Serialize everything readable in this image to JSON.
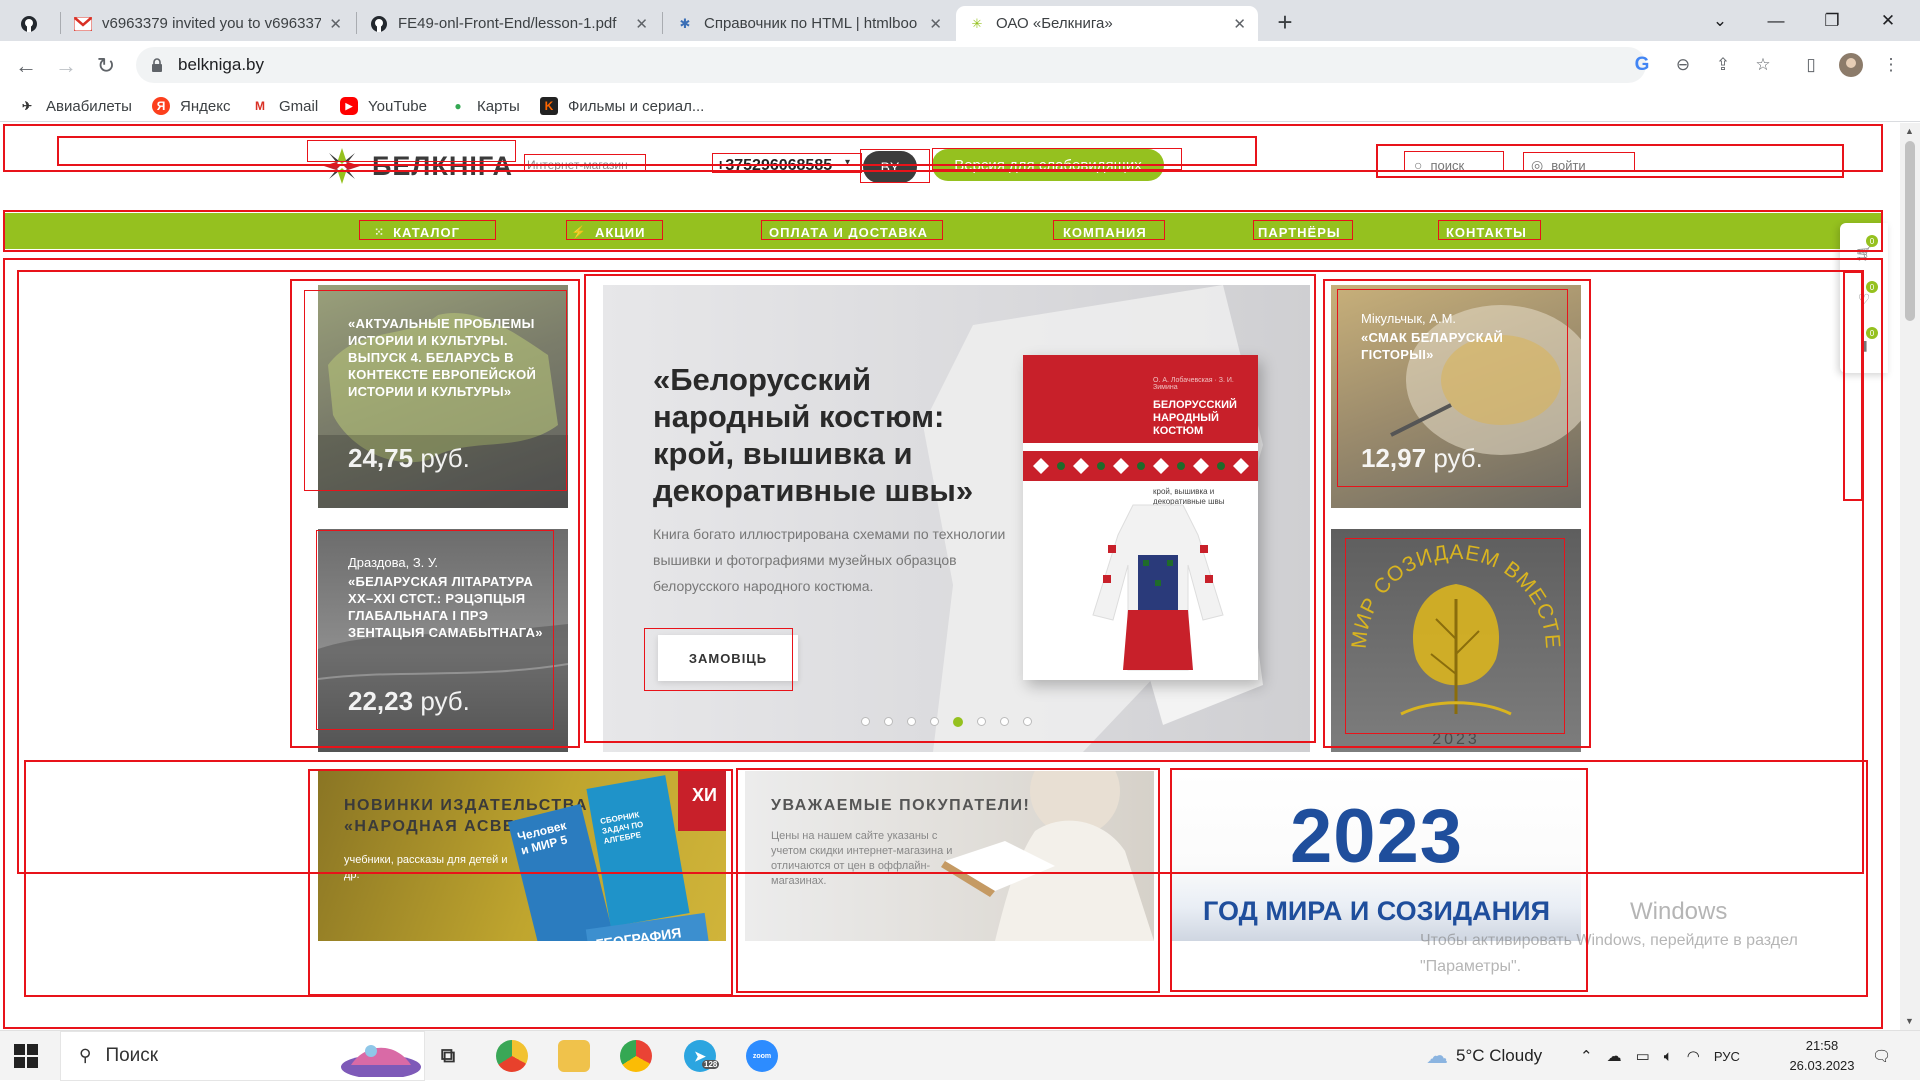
{
  "browser": {
    "tabs": [
      {
        "title": "",
        "icon": "github-icon"
      },
      {
        "title": "v6963379 invited you to v696337",
        "icon": "gmail-icon"
      },
      {
        "title": "FE49-onl-Front-End/lesson-1.pdf",
        "icon": "github-icon"
      },
      {
        "title": "Справочник по HTML | htmlboo",
        "icon": "htmlbook-icon"
      },
      {
        "title": "ОАО «Белкнига»",
        "icon": "belkniga-icon",
        "active": true
      }
    ],
    "url": "belkniga.by",
    "bookmarks": [
      {
        "label": "Авиабилеты",
        "icon": "plane-icon"
      },
      {
        "label": "Яндекс",
        "icon": "yandex-icon"
      },
      {
        "label": "Gmail",
        "icon": "gmail-icon"
      },
      {
        "label": "YouTube",
        "icon": "youtube-icon"
      },
      {
        "label": "Карты",
        "icon": "maps-pin-icon"
      },
      {
        "label": "Фильмы и сериал...",
        "icon": "kinopoisk-icon"
      }
    ]
  },
  "header": {
    "logo_text": "БЕЛКНIГА",
    "shop_link": "Интернет-магазин",
    "phone": "+375296068585",
    "lang": "BY",
    "accessibility": "Версия для слабовидящих",
    "search": "поиск",
    "login": "войти"
  },
  "menu": [
    "КАТАЛОГ",
    "АКЦИИ",
    "ОПЛАТА И ДОСТАВКА",
    "КОМПАНИЯ",
    "ПАРТНЁРЫ",
    "КОНТАКТЫ"
  ],
  "cards": {
    "history": {
      "title": "«АКТУАЛЬНЫЕ ПРОБЛЕМЫ ИСТОРИИ И КУЛЬТУРЫ. ВЫПУСК 4. БЕЛАРУСЬ В КОНТЕКСТЕ ЕВРОПЕЙСКОЙ ИСТОРИИ И КУЛЬТУРЫ»",
      "price": "24,75",
      "currency": "руб."
    },
    "literature": {
      "author": "Драздова, З. У.",
      "title": "«БЕЛАРУСКАЯ ЛІТАРАТУРА XX–XXI СТСТ.: РЭЦЭПЦЫЯ ГЛАБАЛЬНАГА І ПРЭ ЗЕНТАЦЫЯ САМАБЫТНАГА»",
      "price": "22,23",
      "currency": "руб."
    },
    "taste": {
      "author": "Мікульчык, А.М.",
      "title": "«СМАК БЕЛАРУСКАЙ ГІСТОРЫІ»",
      "price": "12,97",
      "currency": "руб."
    },
    "peace_emblem": {
      "arc": "МИР СОЗИДАЕМ ВМЕСТЕ",
      "year": "2023"
    }
  },
  "hero": {
    "title": "«Белорусский народный костюм: крой, вышивка и декоративные швы»",
    "description": "Книга богато иллюстрирована схемами по технологии вышивки и фотографиями музейных образцов белорусского народного костюма.",
    "button": "ЗАМОВIЦЬ",
    "book_author": "О. А. Лобачевская · З. И. Зимина",
    "book_title": "БЕЛОРУССКИЙ НАРОДНЫЙ КОСТЮМ",
    "book_subtitle": "крой, вышивка и декоративные швы",
    "slides_total": 8,
    "slide_active": 5
  },
  "promos": {
    "novelties": {
      "title": "НОВИНКИ ИЗДАТЕЛЬСТВА «НАРОДНАЯ АСВЕТА»",
      "text": "учебники, рассказы для детей и др.",
      "books": [
        "Человек и МИР 5",
        "СБОРНИК ЗАДАЧ ПО АЛГЕБРЕ",
        "ГЕОГРАФИЯ",
        "ХИ"
      ]
    },
    "buyers": {
      "title": "УВАЖАЕМЫЕ ПОКУПАТЕЛИ!",
      "text": "Цены на нашем сайте указаны с учетом скидки интернет-магазина и отличаются от цен в оффлайн-магазинах."
    },
    "year": {
      "big": "2023",
      "line": "ГОД МИРА И СОЗИДАНИЯ"
    }
  },
  "side_widget": {
    "cart": "0",
    "favorites": "0",
    "compare": "0"
  },
  "watermark": {
    "heading": "Windows",
    "line1": "Чтобы активировать Windows, перейдите в раздел",
    "line2": "\"Параметры\"."
  },
  "taskbar": {
    "search": "Поиск",
    "telegram_badge": "128",
    "weather": "5°C Cloudy",
    "lang": "РУС",
    "time": "21:58",
    "date": "26.03.2023"
  },
  "colors": {
    "brand_green": "#95c11f",
    "annotation_red": "#e8131a",
    "year_blue": "#1f4e9c"
  }
}
